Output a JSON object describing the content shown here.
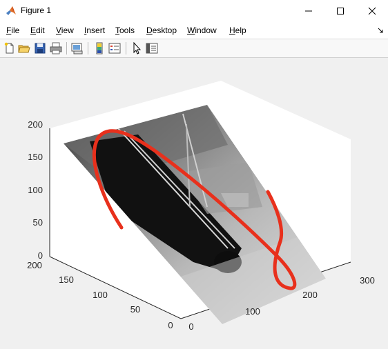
{
  "window": {
    "title": "Figure 1",
    "icons": {
      "app": "matlab-logo-icon",
      "minimize": "minimize-icon",
      "maximize": "maximize-icon",
      "close": "close-icon"
    }
  },
  "menu": {
    "items": [
      {
        "label": "File",
        "u": "F",
        "rest": "ile"
      },
      {
        "label": "Edit",
        "u": "E",
        "rest": "dit"
      },
      {
        "label": "View",
        "u": "V",
        "rest": "iew"
      },
      {
        "label": "Insert",
        "u": "I",
        "rest": "nsert"
      },
      {
        "label": "Tools",
        "u": "T",
        "rest": "ools"
      },
      {
        "label": "Desktop",
        "u": "D",
        "rest": "esktop"
      },
      {
        "label": "Window",
        "u": "W",
        "rest": "indow"
      },
      {
        "label": "Help",
        "u": "H",
        "rest": "elp"
      }
    ],
    "dock_icon": "dock-arrow-icon"
  },
  "toolbar": {
    "icons": [
      "new-figure-icon",
      "open-file-icon",
      "save-icon",
      "print-icon",
      "link-plot-icon",
      "colorbar-icon",
      "legend-icon",
      "pointer-icon",
      "property-inspector-icon"
    ]
  },
  "axes": {
    "z_ticks": [
      "0",
      "50",
      "100",
      "150",
      "200"
    ],
    "y_ticks": [
      "0",
      "50",
      "100",
      "150",
      "200"
    ],
    "x_ticks": [
      "0",
      "100",
      "200",
      "300"
    ],
    "curve_color": "#e8301c"
  }
}
